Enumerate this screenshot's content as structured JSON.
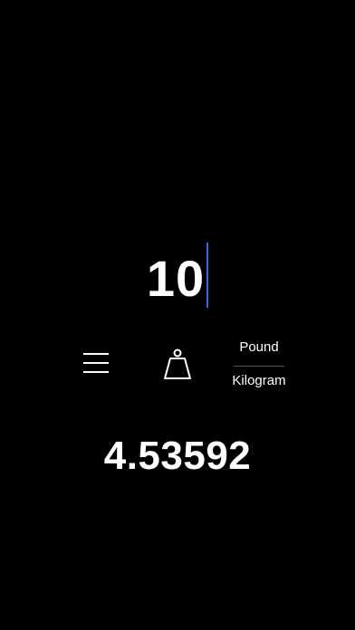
{
  "input": {
    "value": "10"
  },
  "units": {
    "from": "Pound",
    "to": "Kilogram",
    "category_icon": "weight-icon"
  },
  "result": {
    "value": "4.53592"
  },
  "colors": {
    "background": "#000000",
    "text": "#ffffff",
    "caret": "#2f6fe0"
  }
}
